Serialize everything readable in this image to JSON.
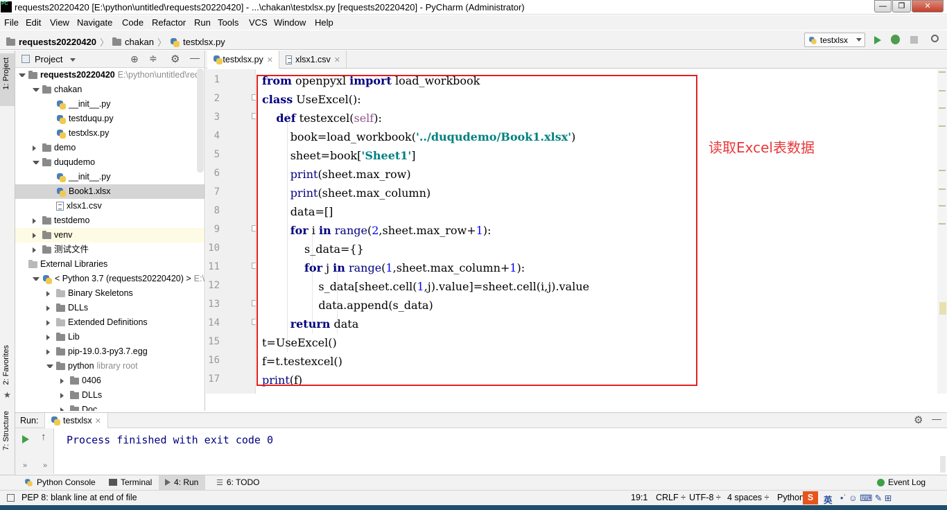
{
  "window": {
    "title": "requests20220420 [E:\\python\\untitled\\requests20220420] - ...\\chakan\\testxlsx.py [requests20220420] - PyCharm (Administrator)",
    "logo_text": "PC",
    "minimize": "—",
    "maximize": "❐",
    "close": "✕"
  },
  "menu": [
    "File",
    "Edit",
    "View",
    "Navigate",
    "Code",
    "Refactor",
    "Run",
    "Tools",
    "VCS",
    "Window",
    "Help"
  ],
  "navbar": {
    "crumbs": [
      "requests20220420",
      "chakan",
      "testxlsx.py"
    ],
    "run_config": "testxlsx"
  },
  "left_strip": {
    "project_tab": "1: Project",
    "favorites_tab": "2: Favorites",
    "structure_tab": "7: Structure"
  },
  "project_panel": {
    "title": "Project",
    "tree": [
      {
        "label": "requests20220420",
        "extra": "E:\\python\\untitled\\requ",
        "indent": 0,
        "icon": "folder",
        "expanded": true,
        "bold": true
      },
      {
        "label": "chakan",
        "indent": 1,
        "icon": "folder",
        "expanded": true
      },
      {
        "label": "__init__.py",
        "indent": 2,
        "icon": "python"
      },
      {
        "label": "testduqu.py",
        "indent": 2,
        "icon": "python"
      },
      {
        "label": "testxlsx.py",
        "indent": 2,
        "icon": "python"
      },
      {
        "label": "demo",
        "indent": 1,
        "icon": "folder",
        "expanded": false
      },
      {
        "label": "duqudemo",
        "indent": 1,
        "icon": "folder",
        "expanded": true
      },
      {
        "label": "__init__.py",
        "indent": 2,
        "icon": "python"
      },
      {
        "label": "Book1.xlsx",
        "indent": 2,
        "icon": "python",
        "selected": true
      },
      {
        "label": "xlsx1.csv",
        "indent": 2,
        "icon": "file"
      },
      {
        "label": "testdemo",
        "indent": 1,
        "icon": "folder",
        "expanded": false
      },
      {
        "label": "venv",
        "indent": 1,
        "icon": "folder",
        "expanded": false,
        "highlight": true
      },
      {
        "label": "测试文件",
        "indent": 1,
        "icon": "folder",
        "expanded": false
      },
      {
        "label": "External Libraries",
        "indent": 0,
        "icon": "lib"
      },
      {
        "label": "< Python 3.7 (requests20220420) >",
        "extra": "E:\\p",
        "indent": 1,
        "icon": "python",
        "expanded": true
      },
      {
        "label": "Binary Skeletons",
        "indent": 2,
        "icon": "lib",
        "expanded": false
      },
      {
        "label": "DLLs",
        "indent": 2,
        "icon": "folder",
        "expanded": false
      },
      {
        "label": "Extended Definitions",
        "indent": 2,
        "icon": "lib",
        "expanded": false
      },
      {
        "label": "Lib",
        "indent": 2,
        "icon": "folder",
        "expanded": false
      },
      {
        "label": "pip-19.0.3-py3.7.egg",
        "indent": 2,
        "icon": "folder",
        "expanded": false
      },
      {
        "label": "python",
        "extra": "library root",
        "indent": 2,
        "icon": "folder",
        "expanded": true
      },
      {
        "label": "0406",
        "indent": 3,
        "icon": "folder",
        "expanded": false
      },
      {
        "label": "DLLs",
        "indent": 3,
        "icon": "folder",
        "expanded": false
      },
      {
        "label": "Doc",
        "indent": 3,
        "icon": "folder",
        "expanded": false
      }
    ]
  },
  "editor": {
    "tabs": [
      {
        "label": "testxlsx.py",
        "active": true
      },
      {
        "label": "xlsx1.csv",
        "active": false
      }
    ],
    "line_numbers": [
      "1",
      "2",
      "3",
      "4",
      "5",
      "6",
      "7",
      "8",
      "9",
      "10",
      "11",
      "12",
      "13",
      "14",
      "15",
      "16",
      "17"
    ],
    "annotation": "读取Excel表数据"
  },
  "run_panel": {
    "label": "Run:",
    "tab": "testxlsx",
    "output": "Process finished with exit code 0"
  },
  "bottom_tabs": [
    "Python Console",
    "Terminal",
    "4: Run",
    "6: TODO"
  ],
  "event_log": "Event Log",
  "status": {
    "message": "PEP 8: blank line at end of file",
    "position": "19:1",
    "line_sep": "CRLF ÷",
    "encoding": "UTF-8 ÷",
    "indent": "4 spaces ÷",
    "interpreter": "Python",
    "ime": "英"
  },
  "colors": {
    "keyword": "#000080",
    "string": "#008080",
    "number": "#0000ff",
    "self": "#94558d",
    "highlight_box": "#e02020",
    "annotation": "#e8383a",
    "run_output": "#000080"
  }
}
